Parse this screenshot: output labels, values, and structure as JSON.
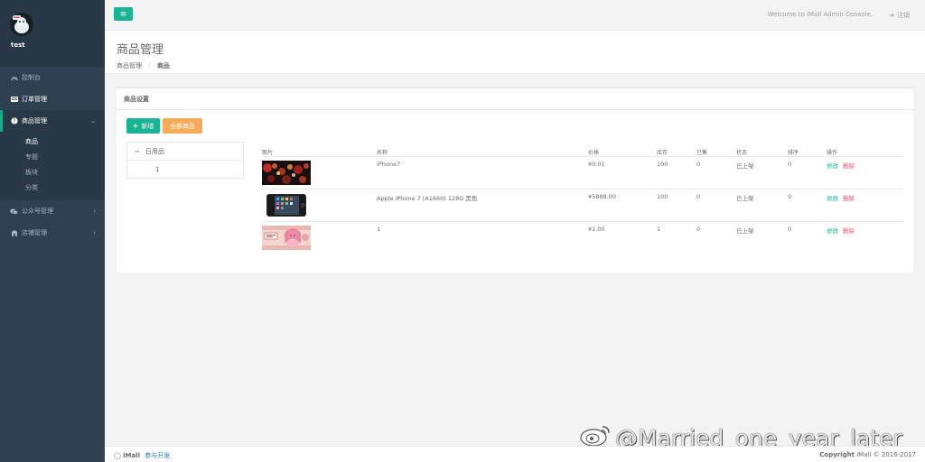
{
  "sidebar": {
    "username": "test",
    "items": [
      {
        "label": "控制台",
        "icon": "dashboard-icon"
      },
      {
        "label": "订单管理",
        "icon": "order-list-icon"
      },
      {
        "label": "商品管理",
        "icon": "product-icon",
        "expanded": true
      },
      {
        "label": "公众号管理",
        "icon": "wechat-icon"
      },
      {
        "label": "店铺管理",
        "icon": "shop-icon"
      }
    ],
    "subitems": [
      "商品",
      "专题",
      "板块",
      "分类"
    ],
    "colors": {
      "bg": "#2f4050",
      "active_border": "#19aa8d"
    }
  },
  "topbar": {
    "welcome": "Welcome to iMall Admin Console.",
    "logout_label": "注销"
  },
  "heading": {
    "title": "商品管理",
    "breadcrumb_parent": "商品管理",
    "breadcrumb_sep": "/",
    "breadcrumb_current": "商品"
  },
  "panel": {
    "title": "商品设置",
    "add_label": "新增",
    "all_label": "全部商品",
    "tree": {
      "root": "日用品",
      "child": "1"
    },
    "table": {
      "headers": [
        "图片",
        "名称",
        "价格",
        "库存",
        "已售",
        "状态",
        "排序",
        "操作"
      ],
      "rows": [
        {
          "name": "iPhone7",
          "price": "¥0.01",
          "stock": "100",
          "sold": "0",
          "status": "已上架",
          "sort": "0",
          "image": "red-bokeh-photo"
        },
        {
          "name": "Apple iPhone 7 (A1660) 128G 黑色",
          "price": "¥5888.00",
          "stock": "100",
          "sold": "0",
          "status": "已上架",
          "sort": "0",
          "image": "black-iphone-photo"
        },
        {
          "name": "1",
          "price": "¥1.00",
          "stock": "1",
          "sold": "0",
          "status": "已上架",
          "sort": "0",
          "image": "anime-banknote-image"
        }
      ],
      "edit_label": "修改",
      "delete_label": "删除"
    }
  },
  "footer": {
    "brand": "iMall",
    "contribute": "参与开发",
    "copyright_bold": "Copyright",
    "copyright_rest": "iMall © 2016-2017"
  },
  "watermark": "@Married_one_year_later",
  "colors": {
    "primary": "#1ab394",
    "warning": "#f8ac59",
    "danger": "#ed5565",
    "link": "#337ab7"
  }
}
